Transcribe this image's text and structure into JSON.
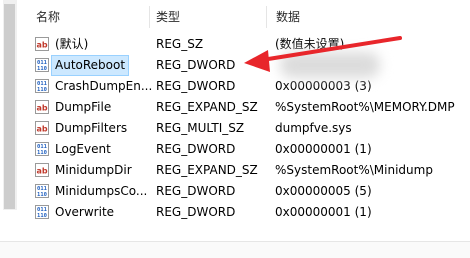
{
  "columns": {
    "name": "名称",
    "type": "类型",
    "data": "数据"
  },
  "rows": [
    {
      "icon": "string-value-icon",
      "name": "(默认)",
      "type": "REG_SZ",
      "data": "(数值未设置)"
    },
    {
      "icon": "binary-value-icon",
      "name": "AutoReboot",
      "type": "REG_DWORD",
      "data": ""
    },
    {
      "icon": "binary-value-icon",
      "name": "CrashDumpEn...",
      "type": "REG_DWORD",
      "data": "0x00000003 (3)"
    },
    {
      "icon": "string-value-icon",
      "name": "DumpFile",
      "type": "REG_EXPAND_SZ",
      "data": "%SystemRoot%\\MEMORY.DMP"
    },
    {
      "icon": "string-value-icon",
      "name": "DumpFilters",
      "type": "REG_MULTI_SZ",
      "data": "dumpfve.sys"
    },
    {
      "icon": "binary-value-icon",
      "name": "LogEvent",
      "type": "REG_DWORD",
      "data": "0x00000001 (1)"
    },
    {
      "icon": "string-value-icon",
      "name": "MinidumpDir",
      "type": "REG_EXPAND_SZ",
      "data": "%SystemRoot%\\Minidump"
    },
    {
      "icon": "binary-value-icon",
      "name": "MinidumpsCo...",
      "type": "REG_DWORD",
      "data": "0x00000005 (5)"
    },
    {
      "icon": "binary-value-icon",
      "name": "Overwrite",
      "type": "REG_DWORD",
      "data": "0x00000001 (1)"
    }
  ],
  "selected_row": "AutoReboot",
  "colors": {
    "selection": "#cce8ff",
    "arrow": "#e8262b",
    "icon_string": "#c0392b",
    "icon_binary": "#1f5fbf"
  }
}
